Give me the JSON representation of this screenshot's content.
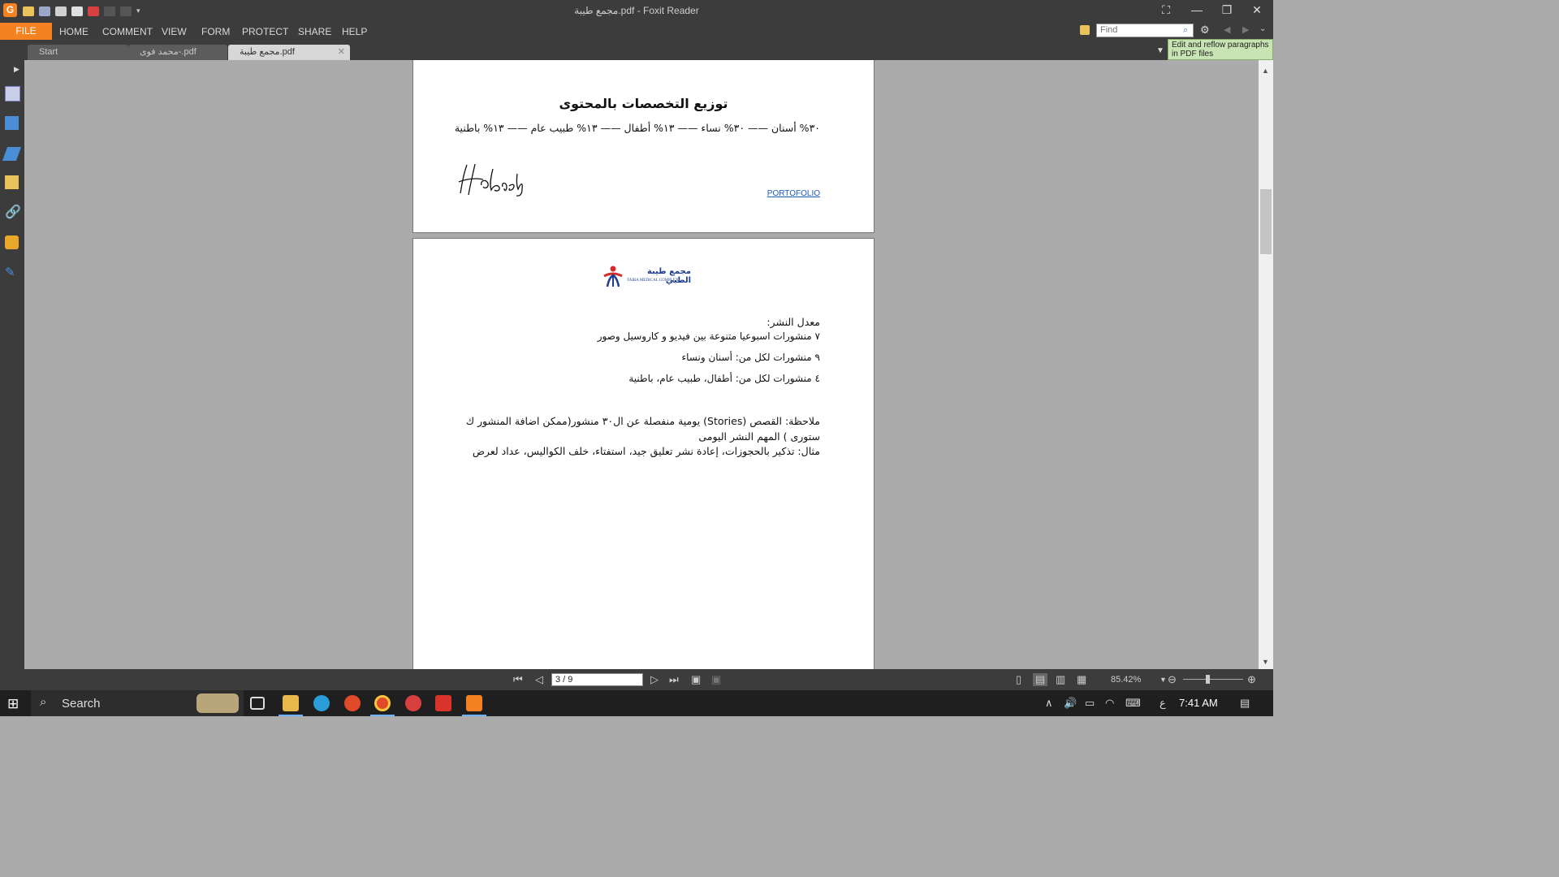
{
  "window": {
    "title": "مجمع طيبة.pdf - Foxit Reader",
    "controls": {
      "fullscreen": "⛶",
      "minimize": "—",
      "restore": "❐",
      "close": "✕"
    }
  },
  "ribbon": {
    "file_label": "FILE",
    "menus": [
      "HOME",
      "COMMENT",
      "VIEW",
      "FORM",
      "PROTECT",
      "SHARE",
      "HELP"
    ],
    "find_placeholder": "Find",
    "tooltip": "Edit and reflow paragraphs in PDF files"
  },
  "tabs": [
    {
      "label": "Start",
      "active": false
    },
    {
      "label": "محمد فوى-.pdf",
      "active": false
    },
    {
      "label": "مجمع طيبة.pdf",
      "active": true
    }
  ],
  "page_a": {
    "heading": "توزيع التخصصات بالمحتوى",
    "distribution": "٣٠% أسنان —— ٣٠% نساء —— ١٣% أطفال —— ١٣% طبيب عام —— ١٣% باطنية",
    "link": "PORTOFOLIO"
  },
  "page_b": {
    "logo_ar": "مجمع طيبة الطبي",
    "logo_en": "TAIBA MEDICAL COMPLEX",
    "rate_label": "معدل النشر:",
    "lines": [
      "٧ منشورات اسبوعيا متنوعة بين فيديو و كاروسيل وصور",
      "٩ منشورات لكل من: أسنان ونساء",
      "٤ منشورات لكل من: أطفال، طبيب عام، باطنية"
    ],
    "note_1": "ملاحظة: القصص (Stories) يومية منفصلة عن ال٣٠ منشور(ممكن اضافة المنشور ك",
    "note_2": "ستورى ) المهم النشر اليومى",
    "example": "مثال: تذكير بالحجوزات، إعادة نشر تعليق جيد، استفتاء، خلف الكواليس، عداد لعرض"
  },
  "nav": {
    "page_display": "3 / 9",
    "zoom": "85.42%"
  },
  "taskbar": {
    "search_label": "Search",
    "clock": "7:41 AM",
    "lang": "ع"
  }
}
